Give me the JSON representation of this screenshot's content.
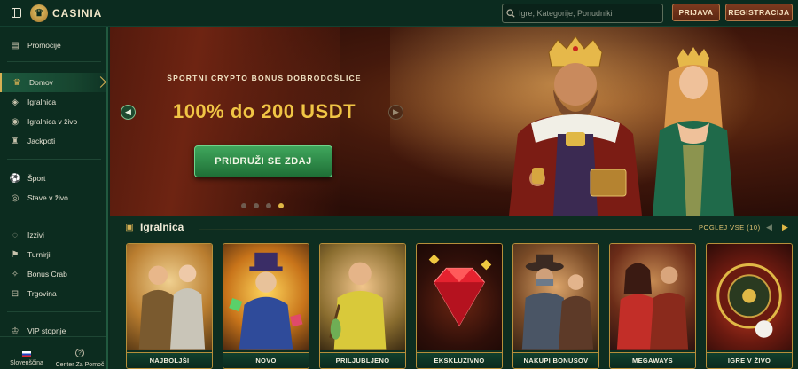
{
  "header": {
    "brand": "CASINIA",
    "search_placeholder": "Igre, Kategorije, Ponudniki",
    "login_label": "PRIJAVA",
    "register_label": "REGISTRACIJA"
  },
  "sidebar": {
    "items": [
      {
        "label": "Promocije",
        "icon": "gift-icon"
      },
      {
        "label": "Domov",
        "icon": "crown-icon",
        "active": true
      },
      {
        "label": "Igralnica",
        "icon": "casino-icon"
      },
      {
        "label": "Igralnica v živo",
        "icon": "live-casino-icon"
      },
      {
        "label": "Jackpoti",
        "icon": "trophy-icon"
      },
      {
        "label": "Šport",
        "icon": "football-icon"
      },
      {
        "label": "Stave v živo",
        "icon": "live-bet-icon"
      },
      {
        "label": "Izzivi",
        "icon": "challenge-icon"
      },
      {
        "label": "Turnirji",
        "icon": "tournament-icon"
      },
      {
        "label": "Bonus Crab",
        "icon": "crab-icon"
      },
      {
        "label": "Trgovina",
        "icon": "shop-icon"
      },
      {
        "label": "VIP stopnje",
        "icon": "vip-icon"
      }
    ],
    "language": "Slovenščina",
    "support": "Center Za Pomoč"
  },
  "hero": {
    "subtitle": "ŠPORTNI CRYPTO BONUS DOBRODOŠLICE",
    "headline": "100% do 200 USDT",
    "cta": "PRIDRUŽI SE ZDAJ"
  },
  "section": {
    "title": "Igralnica",
    "view_all": "POGLEJ VSE (10)"
  },
  "games": [
    {
      "label": "NAJBOLJŠI"
    },
    {
      "label": "NOVO"
    },
    {
      "label": "PRILJUBLJENO"
    },
    {
      "label": "EKSKLUZIVNO"
    },
    {
      "label": "NAKUPI BONUSOV"
    },
    {
      "label": "MEGAWAYS"
    },
    {
      "label": "IGRE V ŽIVO"
    }
  ],
  "colors": {
    "background": "#0b2a1e",
    "accent_gold": "#d6b053",
    "cta_green": "#2f8b49",
    "button_brown": "#6b2f18"
  }
}
